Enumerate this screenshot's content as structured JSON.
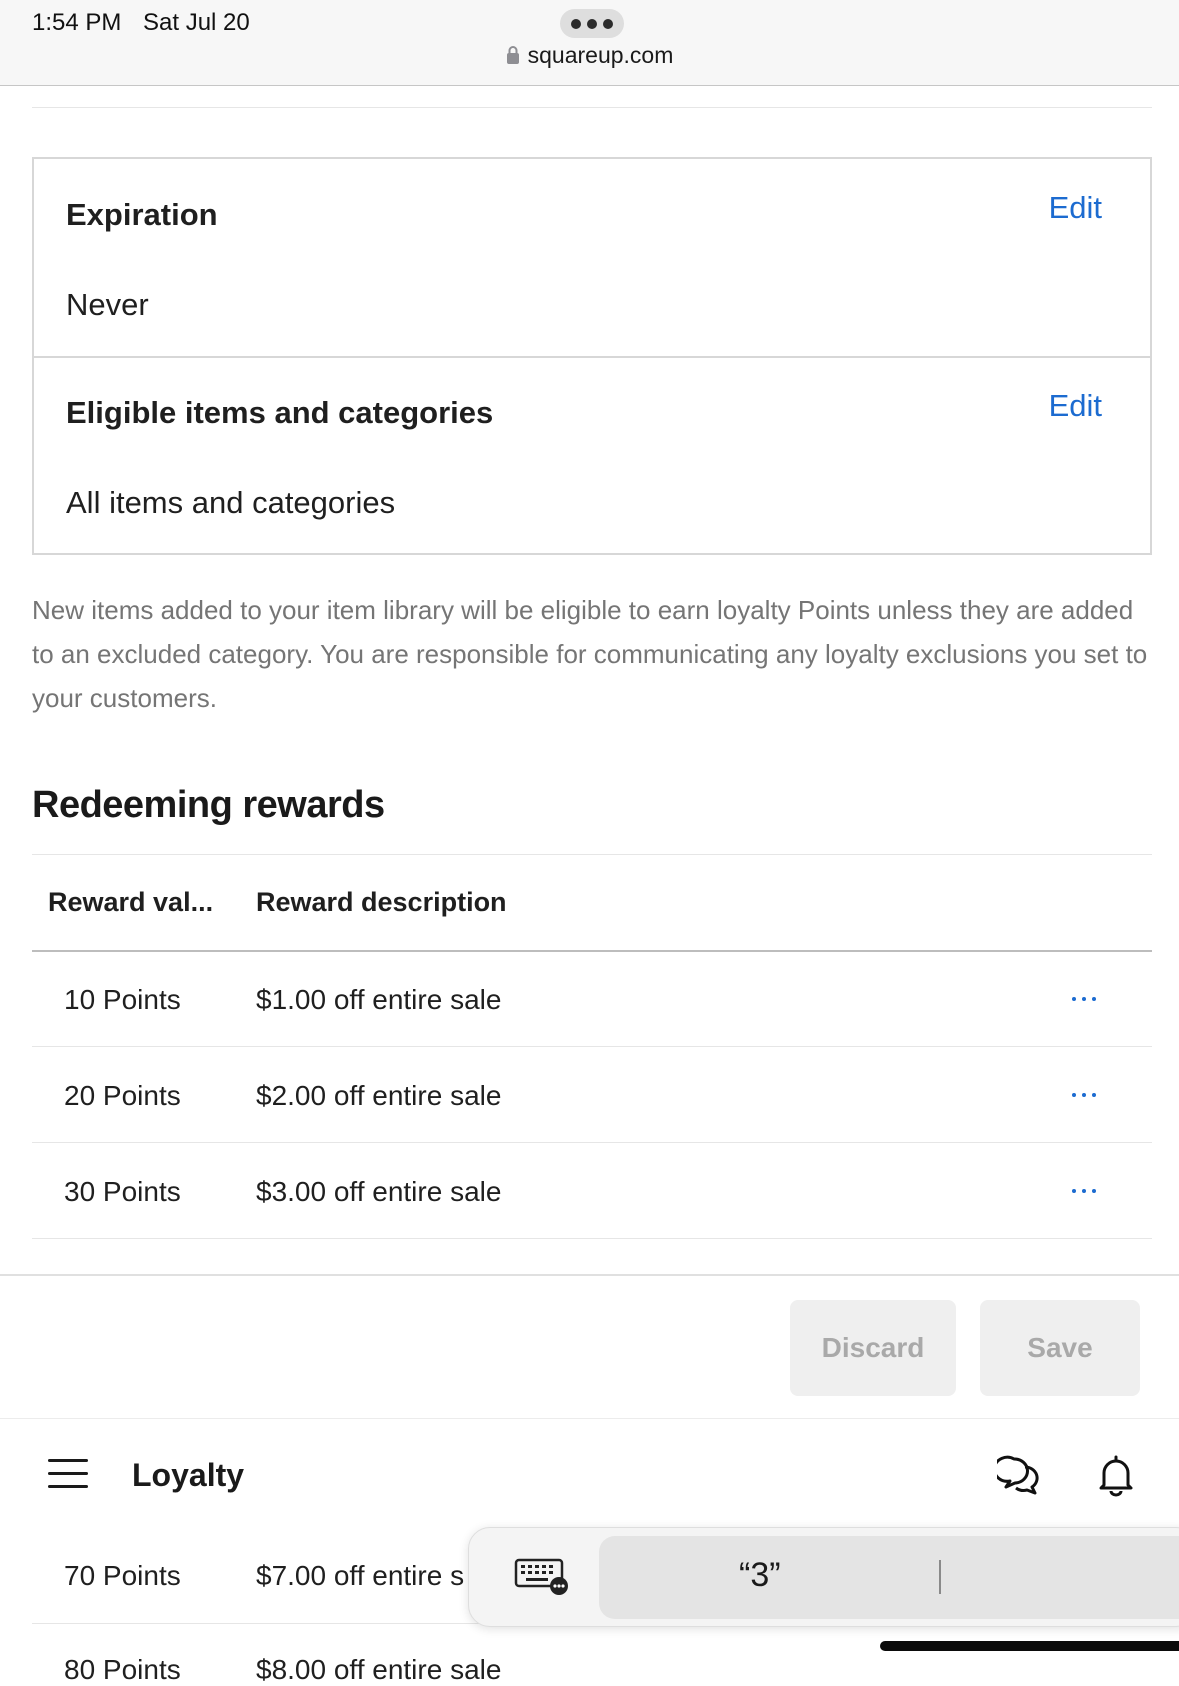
{
  "status_bar": {
    "time": "1:54 PM",
    "date": "Sat Jul 20",
    "url": "squareup.com"
  },
  "expiration": {
    "title": "Expiration",
    "value": "Never",
    "edit_label": "Edit"
  },
  "eligible": {
    "title": "Eligible items and categories",
    "value": "All items and categories",
    "edit_label": "Edit"
  },
  "note": "New items added to your item library will be eligible to earn loyalty Points unless they are added to an excluded category. You are responsible for communicating any loyalty exclusions you set to your customers.",
  "redeeming": {
    "heading": "Redeeming rewards",
    "columns": [
      "Reward val...",
      "Reward description"
    ],
    "rows": [
      {
        "value": "10 Points",
        "description": "$1.00 off entire sale"
      },
      {
        "value": "20 Points",
        "description": "$2.00 off entire sale"
      },
      {
        "value": "30 Points",
        "description": "$3.00 off entire sale"
      }
    ],
    "peek_rows": [
      {
        "value": "70 Points",
        "description": "$7.00 off entire s"
      },
      {
        "value": "80 Points",
        "description": "$8.00 off entire sale"
      }
    ]
  },
  "actions": {
    "discard_label": "Discard",
    "save_label": "Save"
  },
  "nav": {
    "title": "Loyalty",
    "menu_icon": "hamburger-menu-icon",
    "messages_icon": "messages-icon",
    "notifications_icon": "bell-icon"
  },
  "keyboard_bar": {
    "keyboard_icon": "keyboard-icon",
    "suggestion": "“3”"
  },
  "colors": {
    "link": "#1c6bd0",
    "muted_text": "#757575",
    "button_bg": "#efefef",
    "button_text": "#a9a9a9"
  }
}
